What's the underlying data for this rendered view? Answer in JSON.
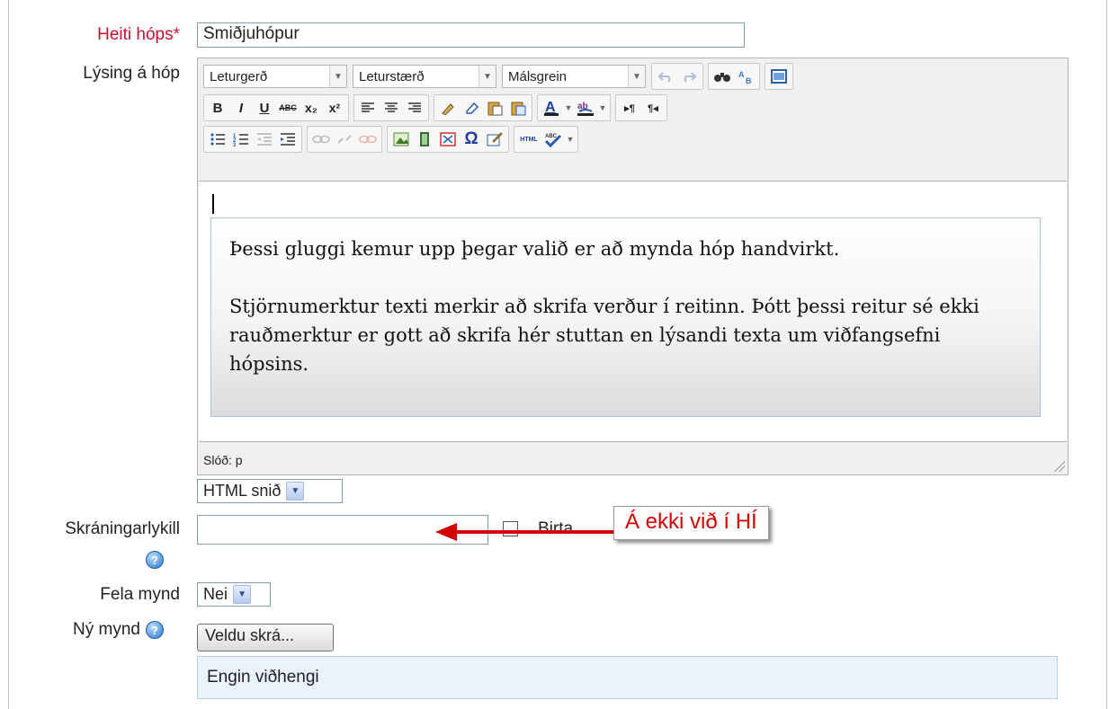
{
  "fields": {
    "group_name": {
      "label": "Heiti hóps",
      "required_mark": "*",
      "value": "Smiðjuhópur"
    },
    "description": {
      "label": "Lýsing á hóp"
    },
    "enrolment_key": {
      "label": "Skráningarlykill",
      "value": "",
      "show_label": "Birta"
    },
    "hide_picture": {
      "label": "Fela mynd",
      "value": "Nei"
    },
    "new_picture": {
      "label": "Ný mynd",
      "button_label": "Veldu skrá...",
      "attachments_text": "Engin viðhengi"
    }
  },
  "editor": {
    "font_family_select": "Leturgerð",
    "font_size_select": "Leturstærð",
    "paragraph_select": "Málsgrein",
    "toolbar_text": {
      "bold": "B",
      "italic": "I",
      "underline": "U",
      "strike": "ABC",
      "subscript": "x₂",
      "superscript": "x²",
      "omega": "Ω",
      "html": "HTML"
    },
    "content_paragraphs": [
      "Þessi gluggi kemur upp þegar valið er að mynda hóp handvirkt.",
      "Stjörnumerktur texti merkir að skrifa verður í reitinn. Þótt þessi reitur sé ekki rauðmerktur er gott að skrifa hér stuttan en lýsandi texta um viðfangsefni hópsins."
    ],
    "path_label": "Slóð: p",
    "format_select": "HTML snið"
  },
  "annotation": {
    "text": "Á ekki við í HÍ",
    "color": "#d40000"
  },
  "colors": {
    "required": "#c8102e",
    "attachment_bg": "#eaf3fc"
  }
}
